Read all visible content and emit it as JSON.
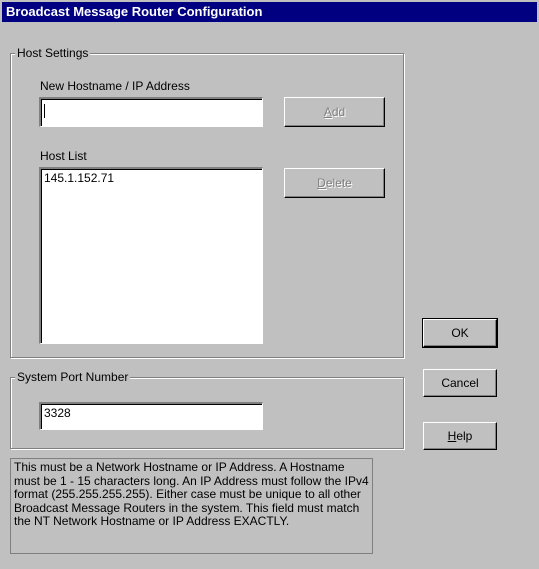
{
  "window": {
    "title": "Broadcast Message Router Configuration"
  },
  "host_settings": {
    "group_label": "Host Settings",
    "hostname_label": "New Hostname / IP Address",
    "hostname_value": "",
    "add_button": {
      "accel": "A",
      "rest": "dd"
    },
    "host_list_label": "Host List",
    "host_list": [
      "145.1.152.71"
    ],
    "delete_button": {
      "accel": "D",
      "rest": "elete"
    }
  },
  "port": {
    "group_label": "System Port Number",
    "value": "3328"
  },
  "buttons": {
    "ok": "OK",
    "cancel": "Cancel",
    "help": {
      "accel": "H",
      "rest": "elp"
    }
  },
  "info_text": "This must be a Network Hostname or IP Address. A Hostname must be 1 - 15 characters long. An IP Address must follow the IPv4 format (255.255.255.255). Either case must be unique to all other Broadcast Message Routers in the system. This field must match the NT Network Hostname or IP Address EXACTLY."
}
